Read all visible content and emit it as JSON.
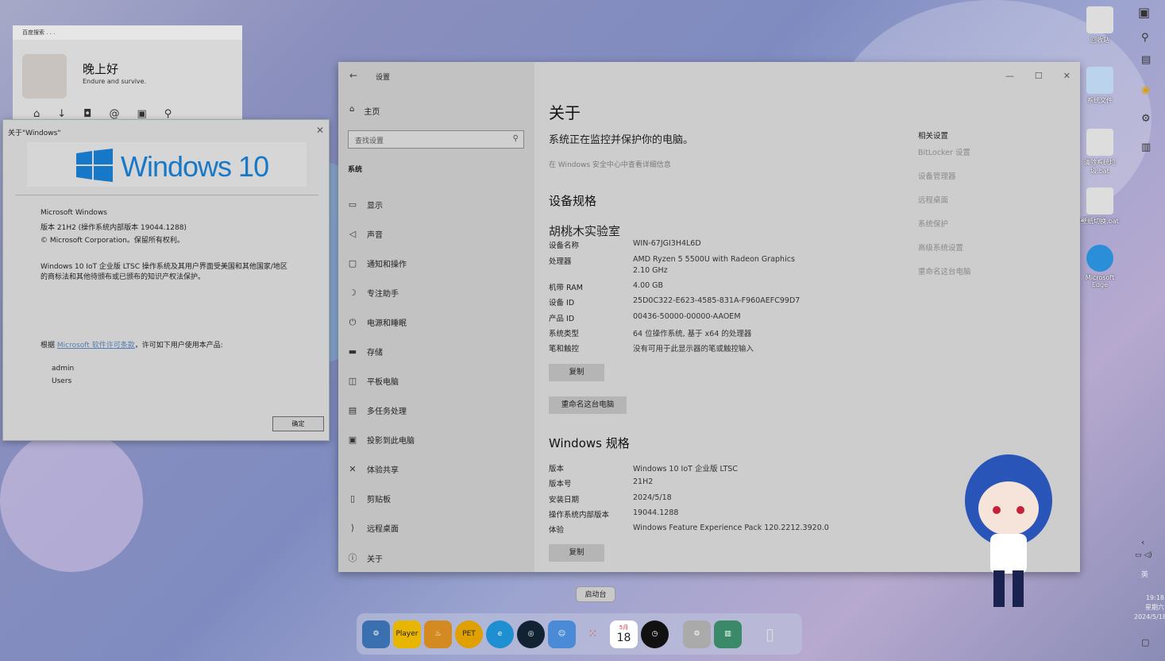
{
  "widget": {
    "search_text": "百度搜索 . . .",
    "greeting": "晚上好",
    "subtitle": "Endure and survive."
  },
  "about": {
    "title": "关于\"Windows\"",
    "logo_text": "Windows 10",
    "lines": [
      "Microsoft Windows",
      "版本 21H2 (操作系统内部版本 19044.1288)",
      "© Microsoft Corporation。保留所有权利。",
      "Windows 10 IoT 企业版 LTSC 操作系统及其用户界面受美国和其他国家/地区",
      "的商标法和其他待颁布或已颁布的知识产权法保护。"
    ],
    "license_prefix": "根据 ",
    "license_link": "Microsoft 软件许可条款",
    "license_suffix": "，许可如下用户使用本产品:",
    "user": "admin",
    "org": "Users",
    "ok": "确定"
  },
  "settings": {
    "app_title": "设置",
    "home": "主页",
    "search_placeholder": "查找设置",
    "section": "系统",
    "nav": [
      {
        "icon": "monitor-icon",
        "label": "显示"
      },
      {
        "icon": "speaker-icon",
        "label": "声音"
      },
      {
        "icon": "notification-icon",
        "label": "通知和操作"
      },
      {
        "icon": "moon-icon",
        "label": "专注助手"
      },
      {
        "icon": "power-icon",
        "label": "电源和睡眠"
      },
      {
        "icon": "storage-icon",
        "label": "存储"
      },
      {
        "icon": "tablet-icon",
        "label": "平板电脑"
      },
      {
        "icon": "multitask-icon",
        "label": "多任务处理"
      },
      {
        "icon": "project-icon",
        "label": "投影到此电脑"
      },
      {
        "icon": "share-icon",
        "label": "体验共享"
      },
      {
        "icon": "clipboard-icon",
        "label": "剪贴板"
      },
      {
        "icon": "remote-icon",
        "label": "远程桌面"
      },
      {
        "icon": "info-icon",
        "label": "关于"
      }
    ],
    "page_title": "关于",
    "monitor_text": "系统正在监控并保护你的电脑。",
    "security_link": "在 Windows 安全中心中查看详细信息",
    "device_spec_title": "设备规格",
    "pc_name": "胡桃木实验室",
    "device_specs": [
      {
        "k": "设备名称",
        "v": "WIN-67JGI3H4L6D"
      },
      {
        "k": "处理器",
        "v": "AMD Ryzen 5 5500U with Radeon Graphics"
      },
      {
        "k": "",
        "v": "2.10 GHz"
      },
      {
        "k": "机带 RAM",
        "v": "4.00 GB"
      },
      {
        "k": "设备 ID",
        "v": "25D0C322-E623-4585-831A-F960AEFC99D7"
      },
      {
        "k": "产品 ID",
        "v": "00436-50000-00000-AAOEM"
      },
      {
        "k": "系统类型",
        "v": "64 位操作系统, 基于 x64 的处理器"
      },
      {
        "k": "笔和触控",
        "v": "没有可用于此显示器的笔或触控输入"
      }
    ],
    "copy": "复制",
    "rename": "重命名这台电脑",
    "win_spec_title": "Windows 规格",
    "win_specs": [
      {
        "k": "版本",
        "v": "Windows 10 IoT 企业版 LTSC"
      },
      {
        "k": "版本号",
        "v": "21H2"
      },
      {
        "k": "安装日期",
        "v": "2024/5/18"
      },
      {
        "k": "操作系统内部版本",
        "v": "19044.1288"
      },
      {
        "k": "体验",
        "v": "Windows Feature Experience Pack 120.2212.3920.0"
      }
    ],
    "related_title": "相关设置",
    "related": [
      "BitLocker 设置",
      "设备管理器",
      "远程桌面",
      "系统保护",
      "高级系统设置",
      "重命名这台电脑"
    ]
  },
  "dock": {
    "tooltip": "启动台",
    "player": "Player",
    "pet": "PET",
    "cal_month": "5月",
    "cal_day": "18"
  },
  "desktop": {
    "recycle": "回收站",
    "sysfiles": "系统文件",
    "clear_bat": "清除系统垃圾.bat",
    "bat2": "壁纸切换.bat",
    "edge": "Microsoft Edge"
  },
  "tray": {
    "lang": "英",
    "time": "19:18",
    "weekday": "星期六",
    "date": "2024/5/18"
  }
}
